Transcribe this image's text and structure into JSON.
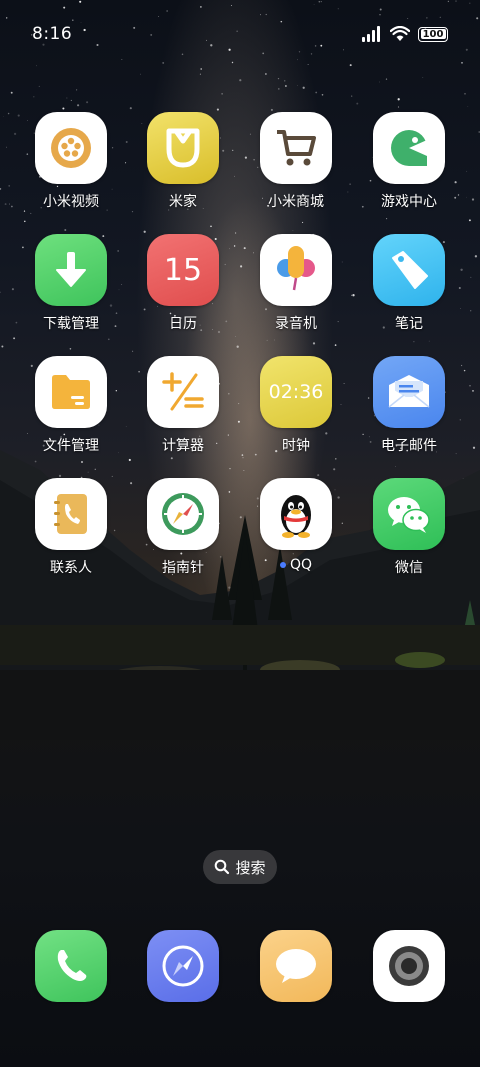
{
  "status_bar": {
    "time": "8:16",
    "battery": "100"
  },
  "apps": [
    {
      "label": "小米视频",
      "icon": "film-reel-icon"
    },
    {
      "label": "米家",
      "icon": "mijia-icon"
    },
    {
      "label": "小米商城",
      "icon": "shopping-cart-icon"
    },
    {
      "label": "游戏中心",
      "icon": "game-pacman-icon"
    },
    {
      "label": "下载管理",
      "icon": "download-arrow-icon"
    },
    {
      "label": "日历",
      "icon": "calendar-icon",
      "value": "15"
    },
    {
      "label": "录音机",
      "icon": "microphone-icon"
    },
    {
      "label": "笔记",
      "icon": "tag-note-icon"
    },
    {
      "label": "文件管理",
      "icon": "folder-icon"
    },
    {
      "label": "计算器",
      "icon": "calculator-icon"
    },
    {
      "label": "时钟",
      "icon": "clock-icon",
      "value": "02:36"
    },
    {
      "label": "电子邮件",
      "icon": "envelope-icon"
    },
    {
      "label": "联系人",
      "icon": "contacts-book-icon"
    },
    {
      "label": "指南针",
      "icon": "compass-icon"
    },
    {
      "label": "QQ",
      "icon": "qq-penguin-icon"
    },
    {
      "label": "微信",
      "icon": "wechat-icon"
    }
  ],
  "search": {
    "label": "搜索"
  },
  "dock": [
    {
      "icon": "phone-icon"
    },
    {
      "icon": "browser-compass-icon"
    },
    {
      "icon": "message-bubble-icon"
    },
    {
      "icon": "camera-lens-icon"
    }
  ],
  "colors": {
    "calendar": "#e85a5a",
    "downloads": "#4cd964",
    "notes": "#44c1f0",
    "mail": "#4d8ef0",
    "wechat": "#36c75c",
    "clock": "#e6d242",
    "mijia": "#e3c934"
  }
}
